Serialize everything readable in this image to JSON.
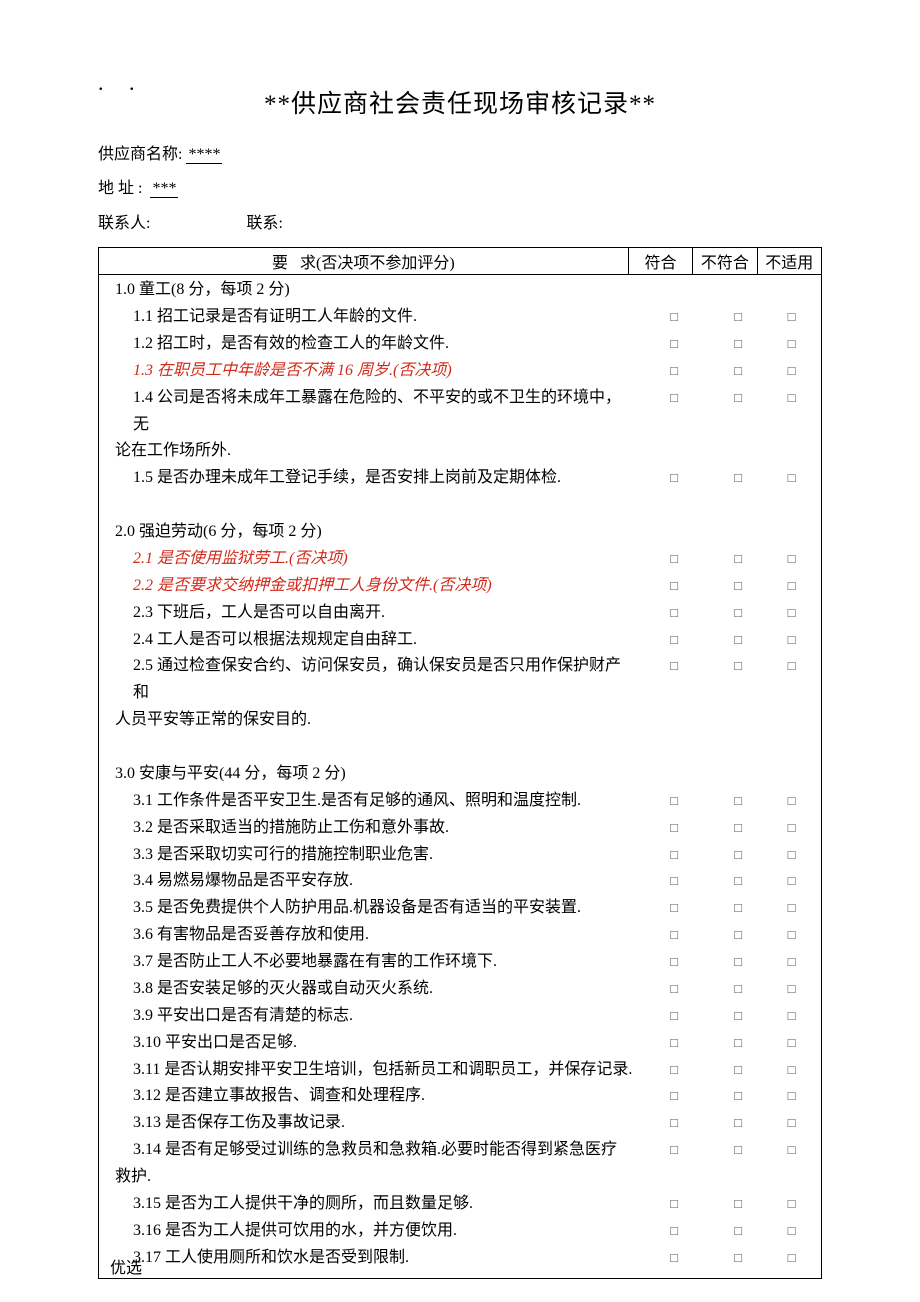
{
  "title": "**供应商社会责任现场审核记录**",
  "meta": {
    "supplier_label": "供应商名称:",
    "supplier_value": "****",
    "address_label": "地址:",
    "address_value": "***",
    "contact_label": "联系人:",
    "contact2_label": "联系:"
  },
  "header": {
    "req_pre": "要",
    "req_post": "求(否决项不参加评分)",
    "ok": "符合",
    "no": "不符合",
    "na": "不适用"
  },
  "footer": "优选",
  "rows": [
    {
      "type": "sec",
      "text": "1.0 童工(8 分，每项 2 分)"
    },
    {
      "type": "item",
      "text": "1.1  招工记录是否有证明工人年龄的文件.",
      "c": true
    },
    {
      "type": "item",
      "text": "1.2 招工时，是否有效的检查工人的年龄文件.",
      "c": true
    },
    {
      "type": "veto",
      "text": "1.3 在职员工中年龄是否不满 16 周岁.(否决项)",
      "c": true
    },
    {
      "type": "item",
      "text": "1.4 公司是否将未成年工暴露在危险的、不平安的或不卫生的环境中，无",
      "c": true
    },
    {
      "type": "cont",
      "text": "论在工作场所外."
    },
    {
      "type": "item",
      "text": "1.5 是否办理未成年工登记手续，是否安排上岗前及定期体检.",
      "c": true
    },
    {
      "type": "blank"
    },
    {
      "type": "sec",
      "text": "2.0 强迫劳动(6 分，每项 2 分)"
    },
    {
      "type": "veto",
      "text": "2.1 是否使用监狱劳工.(否决项)",
      "c": true
    },
    {
      "type": "veto",
      "text": "2.2 是否要求交纳押金或扣押工人身份文件.(否决项)",
      "c": true
    },
    {
      "type": "item",
      "text": "2.3 下班后，工人是否可以自由离开.",
      "c": true
    },
    {
      "type": "item",
      "text": "2.4 工人是否可以根据法规规定自由辞工.",
      "c": true
    },
    {
      "type": "item",
      "text": "2.5 通过检查保安合约、访问保安员，确认保安员是否只用作保护财产和",
      "c": true
    },
    {
      "type": "cont",
      "text": "人员平安等正常的保安目的."
    },
    {
      "type": "blank"
    },
    {
      "type": "sec",
      "text": "3.0 安康与平安(44 分，每项 2 分)"
    },
    {
      "type": "item",
      "text": "3.1 工作条件是否平安卫生.是否有足够的通风、照明和温度控制.",
      "c": true
    },
    {
      "type": "item",
      "text": "3.2 是否采取适当的措施防止工伤和意外事故.",
      "c": true
    },
    {
      "type": "item",
      "text": "3.3 是否采取切实可行的措施控制职业危害.",
      "c": true
    },
    {
      "type": "item",
      "text": "3.4 易燃易爆物品是否平安存放.",
      "c": true
    },
    {
      "type": "item",
      "text": "3.5 是否免费提供个人防护用品.机器设备是否有适当的平安装置.",
      "c": true
    },
    {
      "type": "item",
      "text": "3.6 有害物品是否妥善存放和使用.",
      "c": true
    },
    {
      "type": "item",
      "text": "3.7 是否防止工人不必要地暴露在有害的工作环境下.",
      "c": true
    },
    {
      "type": "item",
      "text": "3.8 是否安装足够的灭火器或自动灭火系统.",
      "c": true
    },
    {
      "type": "item",
      "text": "3.9 平安出口是否有清楚的标志.",
      "c": true
    },
    {
      "type": "item",
      "text": "3.10 平安出口是否足够.",
      "c": true
    },
    {
      "type": "item",
      "text": "3.11 是否认期安排平安卫生培训，包括新员工和调职员工，并保存记录.",
      "c": true
    },
    {
      "type": "item",
      "text": "3.12 是否建立事故报告、调查和处理程序.",
      "c": true
    },
    {
      "type": "item",
      "text": "3.13 是否保存工伤及事故记录.",
      "c": true
    },
    {
      "type": "item",
      "text": "3.14 是否有足够受过训练的急救员和急救箱.必要时能否得到紧急医疗",
      "c": true
    },
    {
      "type": "cont",
      "text": "救护."
    },
    {
      "type": "item",
      "text": "3.15 是否为工人提供干净的厕所，而且数量足够.",
      "c": true
    },
    {
      "type": "item",
      "text": "3.16 是否为工人提供可饮用的水，并方便饮用.",
      "c": true
    },
    {
      "type": "item",
      "text": "3.17 工人使用厕所和饮水是否受到限制.",
      "c": true
    }
  ]
}
